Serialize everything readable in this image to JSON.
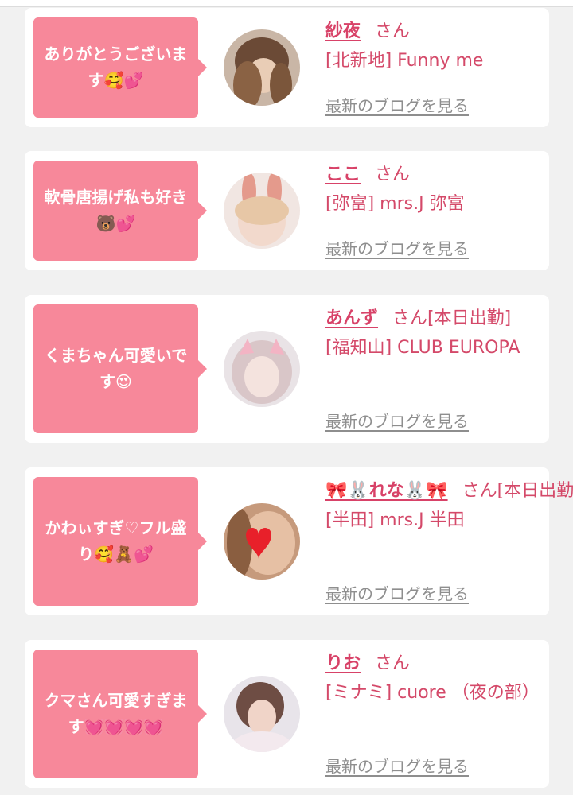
{
  "posts": [
    {
      "comment": "ありがとうございます🥰💕",
      "name": "紗夜",
      "suffix": "さん",
      "shop": "[北新地] Funny me",
      "blog_link": "最新のブログを見る"
    },
    {
      "comment": "軟骨唐揚げ私も好き🐻💕",
      "name": "ここ",
      "suffix": "さん",
      "shop": "[弥富] mrs.J 弥富",
      "blog_link": "最新のブログを見る"
    },
    {
      "comment": "くまちゃん可愛いです😍",
      "name": "あんず",
      "suffix": "さん[本日出勤]",
      "shop": "[福知山] CLUB EUROPA",
      "blog_link": "最新のブログを見る"
    },
    {
      "comment": "かわぃすぎ♡フル盛り🥰🧸💕",
      "name": "🎀🐰れな🐰🎀",
      "suffix": "さん[本日出勤]",
      "shop": "[半田] mrs.J 半田",
      "blog_link": "最新のブログを見る"
    },
    {
      "comment": "クマさん可愛すぎます💓💓💓💓",
      "name": "りお",
      "suffix": "さん",
      "shop": "[ミナミ] cuore （夜の部）",
      "blog_link": "最新のブログを見る"
    }
  ],
  "colors": {
    "accent_pink": "#f7889a",
    "name_pink": "#d84268",
    "text_pink": "#d44969",
    "link_gray": "#8e8e8e",
    "background": "#f1f1f1"
  }
}
